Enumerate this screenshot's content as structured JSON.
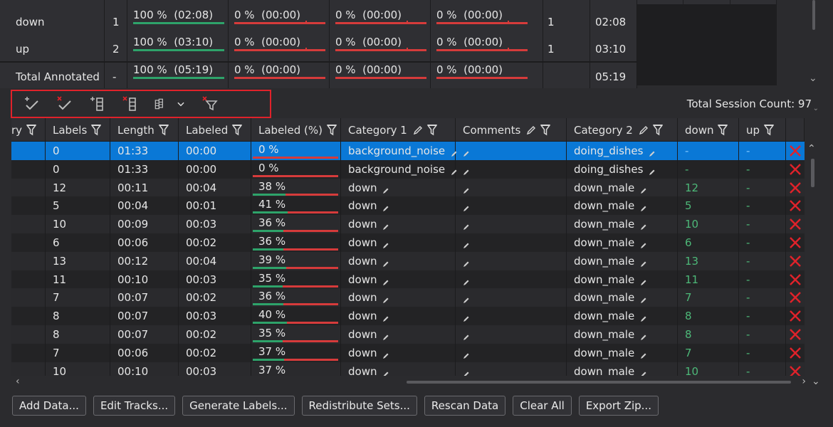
{
  "summary": {
    "rows": [
      {
        "name": "down",
        "count": "1",
        "p1": "100 %  (02:08)",
        "p1f": 1.0,
        "p2": "0 %  (00:00)",
        "p3": "0 %  (00:00)",
        "p4": "0 %  (00:00)",
        "tracks": "1",
        "duration": "02:08"
      },
      {
        "name": "up",
        "count": "2",
        "p1": "100 %  (03:10)",
        "p1f": 1.0,
        "p2": "0 %  (00:00)",
        "p3": "0 %  (00:00)",
        "p4": "0 %  (00:00)",
        "tracks": "1",
        "duration": "03:10"
      },
      {
        "name": "Total Annotated",
        "count": "-",
        "p1": "100 %  (05:19)",
        "p1f": 1.0,
        "p2": "0 %  (00:00)",
        "p3": "0 %  (00:00)",
        "p4": "0 %  (00:00)",
        "tracks": "",
        "duration": "05:19"
      }
    ]
  },
  "toolbar": {
    "icons": [
      "add-check-icon",
      "remove-check-icon",
      "add-column-icon",
      "remove-column-icon",
      "columns-icon",
      "chevron-down-icon",
      "clear-filter-icon"
    ]
  },
  "session_count": "Total Session Count: 97",
  "grid": {
    "headers": {
      "first": "ry",
      "labels": "Labels",
      "length": "Length",
      "labeled": "Labeled",
      "labeled_pct": "Labeled (%)",
      "category1": "Category 1",
      "comments": "Comments",
      "category2": "Category 2",
      "down": "down",
      "up": "up"
    },
    "rows": [
      {
        "labels": "0",
        "length": "01:33",
        "labeled": "00:00",
        "pct": "0 %",
        "pctf": 0.0,
        "cat1": "background_noise",
        "cat2": "doing_dishes",
        "down": "-",
        "up": "-",
        "selected": true
      },
      {
        "labels": "0",
        "length": "01:33",
        "labeled": "00:00",
        "pct": "0 %",
        "pctf": 0.0,
        "cat1": "background_noise",
        "cat2": "doing_dishes",
        "down": "-",
        "up": "-",
        "selected": false
      },
      {
        "labels": "12",
        "length": "00:11",
        "labeled": "00:04",
        "pct": "38 %",
        "pctf": 0.38,
        "cat1": "down",
        "cat2": "down_male",
        "down": "12",
        "up": "-",
        "selected": false
      },
      {
        "labels": "5",
        "length": "00:04",
        "labeled": "00:01",
        "pct": "41 %",
        "pctf": 0.41,
        "cat1": "down",
        "cat2": "down_male",
        "down": "5",
        "up": "-",
        "selected": false
      },
      {
        "labels": "10",
        "length": "00:09",
        "labeled": "00:03",
        "pct": "36 %",
        "pctf": 0.36,
        "cat1": "down",
        "cat2": "down_male",
        "down": "10",
        "up": "-",
        "selected": false
      },
      {
        "labels": "6",
        "length": "00:06",
        "labeled": "00:02",
        "pct": "36 %",
        "pctf": 0.36,
        "cat1": "down",
        "cat2": "down_male",
        "down": "6",
        "up": "-",
        "selected": false
      },
      {
        "labels": "13",
        "length": "00:12",
        "labeled": "00:04",
        "pct": "39 %",
        "pctf": 0.39,
        "cat1": "down",
        "cat2": "down_male",
        "down": "13",
        "up": "-",
        "selected": false
      },
      {
        "labels": "11",
        "length": "00:10",
        "labeled": "00:03",
        "pct": "35 %",
        "pctf": 0.35,
        "cat1": "down",
        "cat2": "down_male",
        "down": "11",
        "up": "-",
        "selected": false
      },
      {
        "labels": "7",
        "length": "00:07",
        "labeled": "00:02",
        "pct": "36 %",
        "pctf": 0.36,
        "cat1": "down",
        "cat2": "down_male",
        "down": "7",
        "up": "-",
        "selected": false
      },
      {
        "labels": "8",
        "length": "00:07",
        "labeled": "00:03",
        "pct": "40 %",
        "pctf": 0.4,
        "cat1": "down",
        "cat2": "down_male",
        "down": "8",
        "up": "-",
        "selected": false
      },
      {
        "labels": "8",
        "length": "00:07",
        "labeled": "00:02",
        "pct": "35 %",
        "pctf": 0.35,
        "cat1": "down",
        "cat2": "down_male",
        "down": "8",
        "up": "-",
        "selected": false
      },
      {
        "labels": "7",
        "length": "00:06",
        "labeled": "00:02",
        "pct": "37 %",
        "pctf": 0.37,
        "cat1": "down",
        "cat2": "down_male",
        "down": "7",
        "up": "-",
        "selected": false
      },
      {
        "labels": "10",
        "length": "00:10",
        "labeled": "00:03",
        "pct": "37 %",
        "pctf": 0.37,
        "cat1": "down",
        "cat2": "down_male",
        "down": "10",
        "up": "-",
        "selected": false
      }
    ]
  },
  "footer": {
    "add_data": "Add Data...",
    "edit_tracks": "Edit Tracks...",
    "generate_labels": "Generate Labels...",
    "redistribute_sets": "Redistribute Sets...",
    "rescan_data": "Rescan Data",
    "clear_all": "Clear All",
    "export_zip": "Export Zip..."
  },
  "colors": {
    "accent": "#0a78d6",
    "progress_done": "#2ea36a",
    "progress_todo": "#d63b3b",
    "highlight_border": "#e0222a",
    "numeric_text": "#4db878"
  }
}
